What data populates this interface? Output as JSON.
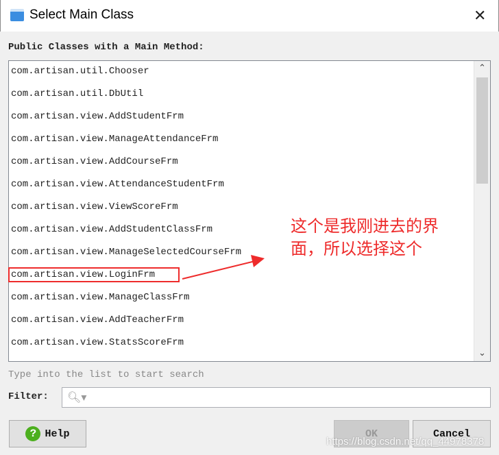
{
  "window": {
    "title": "Select Main Class",
    "close": "✕"
  },
  "list": {
    "label": "Public Classes with a Main Method:",
    "items": [
      "com.artisan.util.Chooser",
      "com.artisan.util.DbUtil",
      "com.artisan.view.AddStudentFrm",
      "com.artisan.view.ManageAttendanceFrm",
      "com.artisan.view.AddCourseFrm",
      "com.artisan.view.AttendanceStudentFrm",
      "com.artisan.view.ViewScoreFrm",
      "com.artisan.view.AddStudentClassFrm",
      "com.artisan.view.ManageSelectedCourseFrm",
      "com.artisan.view.LoginFrm",
      "com.artisan.view.ManageClassFrm",
      "com.artisan.view.AddTeacherFrm",
      "com.artisan.view.StatsScoreFrm"
    ],
    "scroll_up": "⌃",
    "scroll_down": "⌄"
  },
  "hint": "Type into the list to start search",
  "filter": {
    "label": "Filter:",
    "value": "",
    "icon": "search-icon"
  },
  "buttons": {
    "help": "Help",
    "ok": "OK",
    "cancel": "Cancel"
  },
  "annotation": {
    "line1": "这个是我刚进去的界",
    "line2": "面，所以选择这个",
    "color": "#ee2b2b"
  },
  "watermark": "https://blog.csdn.net/qq_44978378"
}
